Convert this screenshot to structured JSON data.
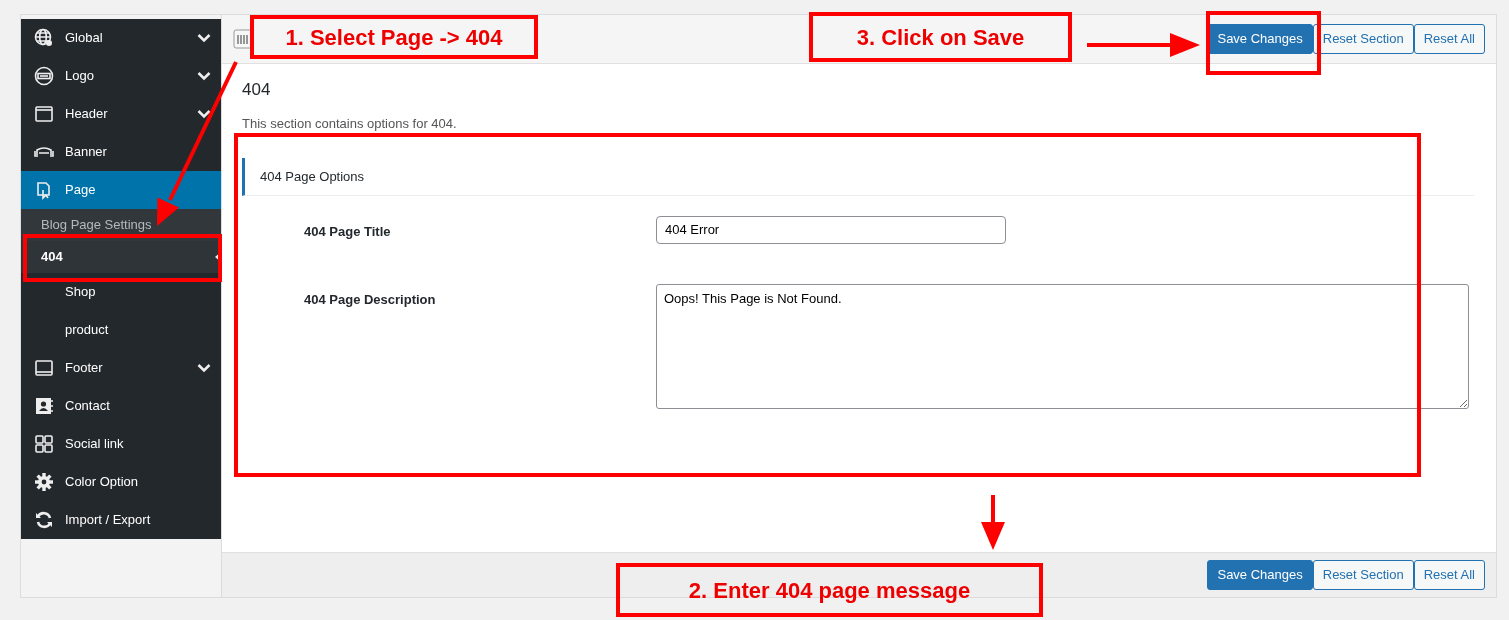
{
  "sidebar": {
    "items": [
      {
        "label": "Global",
        "selected": false,
        "collapsible": true
      },
      {
        "label": "Logo",
        "selected": false,
        "collapsible": true
      },
      {
        "label": "Header",
        "selected": false,
        "collapsible": true
      },
      {
        "label": "Banner",
        "selected": false,
        "collapsible": false
      },
      {
        "label": "Page",
        "selected": true,
        "collapsible": false,
        "children": [
          {
            "label": "Blog Page Settings",
            "selected": false
          },
          {
            "label": "404",
            "selected": true
          }
        ]
      },
      {
        "label": "Shop",
        "selected": false,
        "collapsible": false
      },
      {
        "label": "product",
        "selected": false,
        "collapsible": false
      },
      {
        "label": "Footer",
        "selected": false,
        "collapsible": true
      },
      {
        "label": "Contact",
        "selected": false,
        "collapsible": false
      },
      {
        "label": "Social link",
        "selected": false,
        "collapsible": false
      },
      {
        "label": "Color Option",
        "selected": false,
        "collapsible": false
      },
      {
        "label": "Import / Export",
        "selected": false,
        "collapsible": false
      }
    ]
  },
  "toolbar": {
    "buttons": [
      {
        "label": "Save Changes",
        "kind": "primary"
      },
      {
        "label": "Reset Section",
        "kind": "secondary"
      },
      {
        "label": "Reset All",
        "kind": "secondary"
      }
    ]
  },
  "section": {
    "title": "404",
    "description": "This section contains options for 404.",
    "group_title": "404 Page Options",
    "fields": [
      {
        "label": "404 Page Title",
        "kind": "text",
        "value": "404 Error"
      },
      {
        "label": "404 Page Description",
        "kind": "textarea",
        "value": "Oops! This Page is Not Found."
      }
    ]
  },
  "footer_bar": {
    "buttons": [
      {
        "label": "Save Changes",
        "kind": "primary"
      },
      {
        "label": "Reset Section",
        "kind": "secondary"
      },
      {
        "label": "Reset All",
        "kind": "secondary"
      }
    ]
  },
  "annotations": [
    {
      "text": "1. Select Page -> 404"
    },
    {
      "text": "3. Click on Save"
    },
    {
      "text": "2. Enter 404 page message"
    }
  ]
}
